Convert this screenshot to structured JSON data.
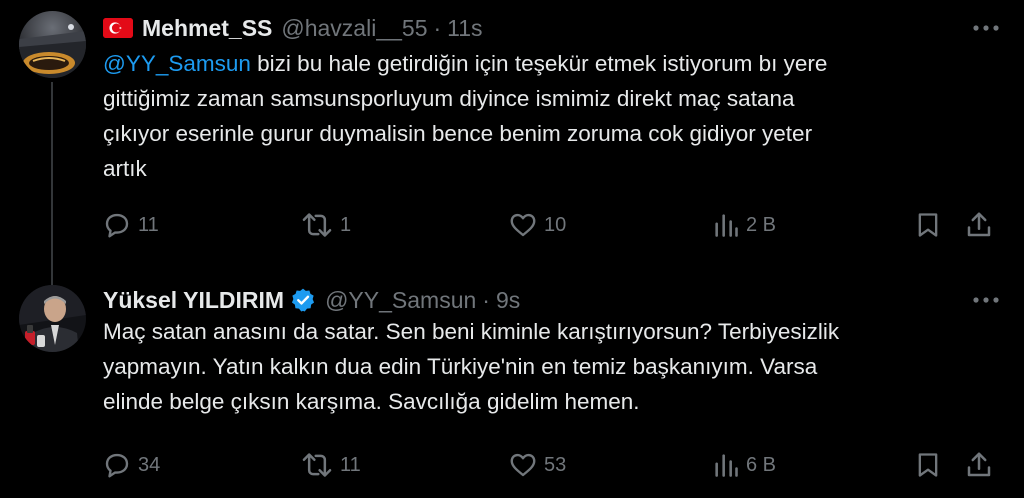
{
  "tweets": [
    {
      "display_name": "Mehmet_SS",
      "handle": "@havzali__55",
      "separator": "·",
      "time": "11s",
      "flag_icon": "turkey-flag-icon",
      "text": {
        "mention": "@YY_Samsun",
        "line1_rest": " bizi bu hale getirdiğin için teşekür etmek istiyorum bı yere",
        "line2": "gittiğimiz zaman samsunsporluyum diyince ismimiz direkt maç satana",
        "line3": "çıkıyor eserinle gurur duymalisin bence benim zoruma cok gidiyor yeter",
        "line4": "artık"
      },
      "actions": {
        "replies": "11",
        "retweets": "1",
        "likes": "10",
        "views": "2 B"
      }
    },
    {
      "display_name": "Yüksel YILDIRIM",
      "handle": "@YY_Samsun",
      "separator": "·",
      "time": "9s",
      "verified": true,
      "text": {
        "line1": "Maç satan anasını da satar. Sen beni kiminle karıştırıyorsun? Terbiyesizlik",
        "line2": "yapmayın. Yatın kalkın dua edin Türkiye'nin en temiz başkanıyım. Varsa",
        "line3": "elinde belge çıksın karşıma. Savcılığa gidelim hemen."
      },
      "actions": {
        "replies": "34",
        "retweets": "11",
        "likes": "53",
        "views": "6 B"
      }
    }
  ],
  "colors": {
    "background": "#000000",
    "text_primary": "#e7e9ea",
    "text_secondary": "#71767b",
    "accent": "#1d9bf0",
    "thread_line": "#333639",
    "flag_red": "#e30a17"
  }
}
